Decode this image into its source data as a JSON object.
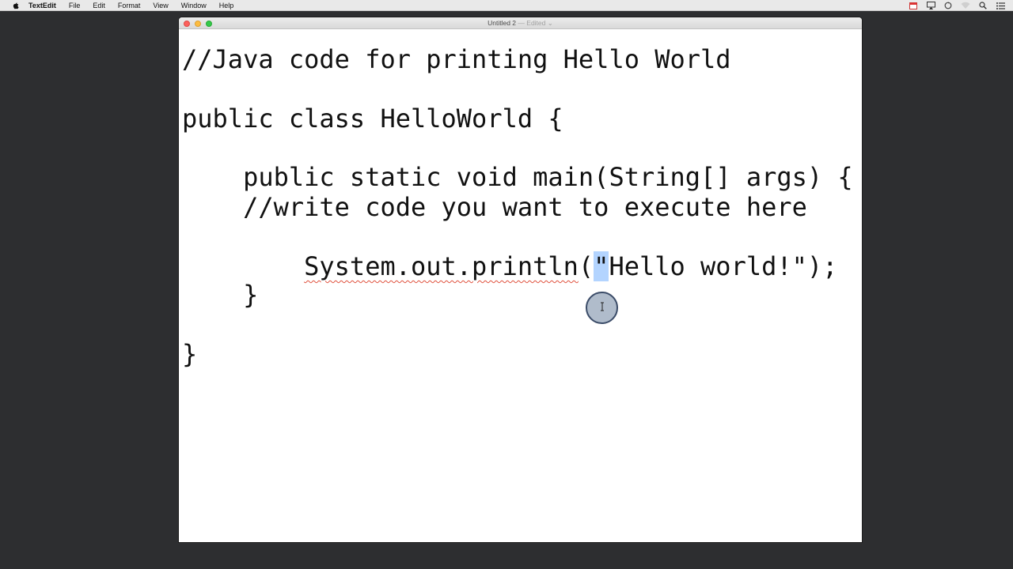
{
  "menubar": {
    "app_name": "TextEdit",
    "items": [
      "File",
      "Edit",
      "Format",
      "View",
      "Window",
      "Help"
    ]
  },
  "window": {
    "title": "Untitled 2",
    "subtitle": " — Edited ⌄"
  },
  "document": {
    "lines": {
      "l1": "//Java code for printing Hello World",
      "l2": "public class HelloWorld {",
      "l3": "    public static void main(String[] args) {",
      "l4": "    //write code you want to execute here",
      "l5_indent": "        ",
      "l5_call": "System.out.println",
      "l5_paren": "(",
      "l5_quote": "\"",
      "l5_rest": "Hello world!\");",
      "l6": "    }",
      "l7": "}"
    }
  },
  "colors": {
    "desktop": "#2d2e30",
    "selection": "#b3d4ff",
    "spellcheck": "#e0503c"
  },
  "icons": {
    "menubar_left": "apple-icon",
    "menubar_right": [
      "calendar-icon",
      "airplay-icon",
      "sync-icon",
      "wifi-icon",
      "spotlight-icon",
      "notification-center-icon"
    ],
    "cursor": "text-cursor-icon"
  }
}
